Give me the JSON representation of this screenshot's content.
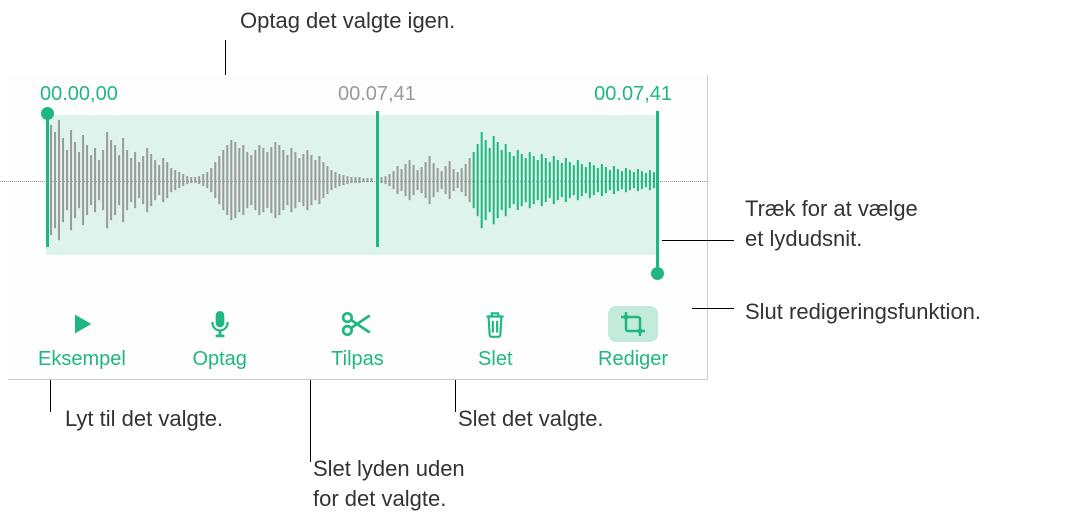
{
  "callouts": {
    "record": "Optag det valgte igen.",
    "drag1": "Træk for at vælge",
    "drag2": "et lydudsnit.",
    "endedit": "Slut redigeringsfunktion.",
    "listen": "Lyt til det valgte.",
    "delsel": "Slet det valgte.",
    "trim1": "Slet lyden uden",
    "trim2": "for det valgte."
  },
  "timeline": {
    "start": "00.00,00",
    "playhead": "00.07,41",
    "end": "00.07,41"
  },
  "toolbar": {
    "preview": "Eksempel",
    "record": "Optag",
    "trim": "Tilpas",
    "delete": "Slet",
    "edit": "Rediger"
  },
  "colors": {
    "accent": "#1fb77f"
  }
}
